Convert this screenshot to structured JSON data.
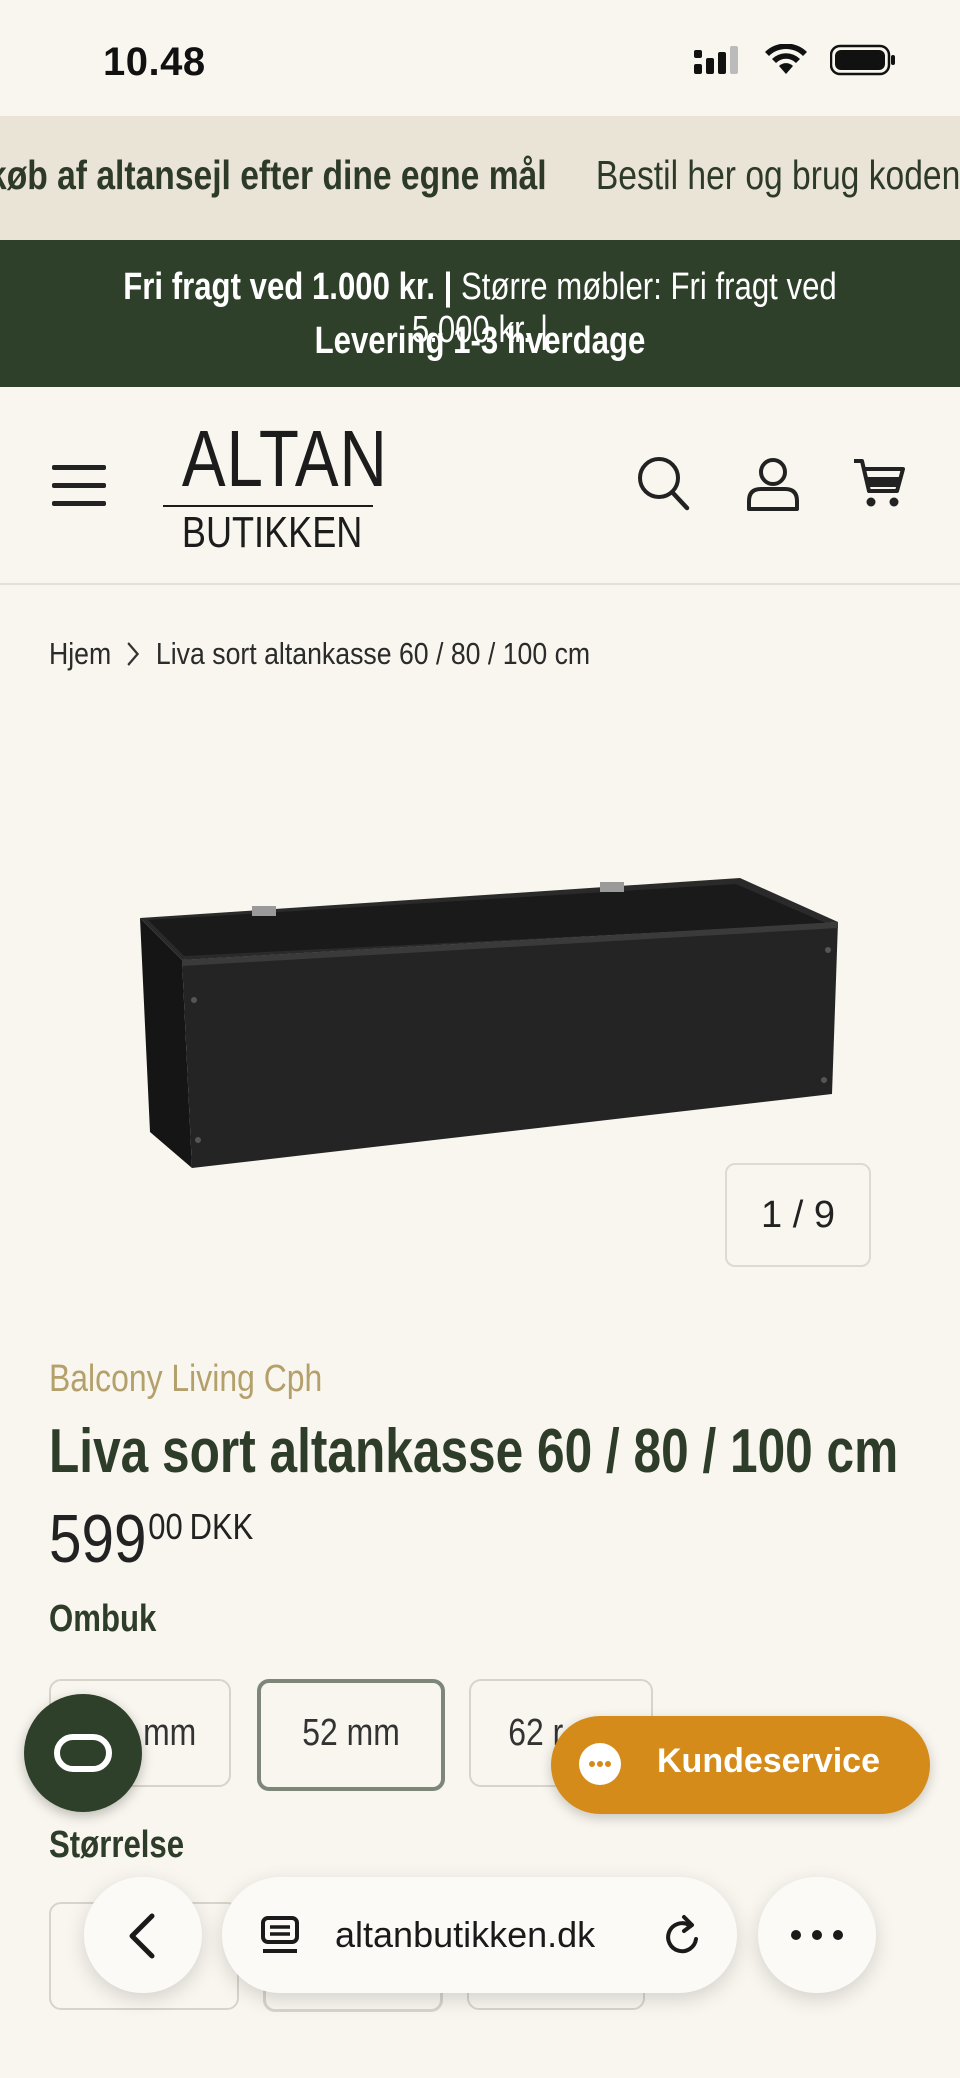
{
  "status": {
    "time": "10.48"
  },
  "marquee": {
    "item1": "køb af altansejl efter dine egne mål",
    "item2": "Bestil her og brug koden S"
  },
  "shipping": {
    "part1": "Fri fragt ved 1.000 kr. |",
    "part2": "Større møbler: Fri fragt ved 5.000 kr. |",
    "line2": "Levering 1-3 hverdage"
  },
  "header": {
    "logo_top": "ALTAN",
    "logo_bottom": "BUTIKKEN"
  },
  "breadcrumb": {
    "home": "Hjem",
    "current": "Liva sort altankasse 60 / 80 / 100 cm"
  },
  "gallery": {
    "counter": "1 / 9"
  },
  "product": {
    "vendor": "Balcony Living Cph",
    "title": "Liva sort altankasse 60 / 80 / 100 cm",
    "price_main": "599",
    "price_decimals": "00",
    "currency": "DKK"
  },
  "options": {
    "ombuk_label": "Ombuk",
    "ombuk_values": [
      "mm",
      "52 mm",
      "62 r"
    ],
    "size_label": "Størrelse"
  },
  "support": {
    "label": "Kundeservice"
  },
  "browser": {
    "url": "altanbutikken.dk"
  },
  "colors": {
    "brand_green": "#2e3f2a",
    "accent_orange": "#d48b1a",
    "vendor_gold": "#b4a06a",
    "background": "#f8f6ee"
  }
}
